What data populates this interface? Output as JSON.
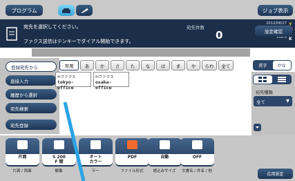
{
  "topbar": {
    "program_label": "プログラム",
    "job_label": "ジョブ表示"
  },
  "message": {
    "line1": "宛先を選択してください。",
    "line2": "ファクス送信はテンキーでダイアル開始できます。",
    "dest_count_label": "宛先件数",
    "dest_count": "0",
    "date": "2012/08/27",
    "time": "11:25",
    "memory": "メモリー残量 C",
    "memory_pct": "100%",
    "toner": [
      "Y",
      "M",
      "C",
      "K"
    ],
    "confirm_label": "設定確認"
  },
  "left_menu": [
    {
      "label": "登録宛先から",
      "active": true
    },
    {
      "label": "直接入力",
      "active": false
    },
    {
      "label": "履歴から選択",
      "active": false
    },
    {
      "label": "宛先検索",
      "active": false
    },
    {
      "label": "宛先登録",
      "active": false
    }
  ],
  "tabs": [
    "常用",
    "あ",
    "か",
    "さ",
    "た",
    "な",
    "は",
    "ま",
    "や",
    "らわ",
    "全て"
  ],
  "kana_toggle": [
    "英字",
    "かな"
  ],
  "addresses": [
    {
      "kind": "ファクス",
      "name": "tokyo-office"
    },
    {
      "kind": "ファクス",
      "name": "osaka-office"
    }
  ],
  "dest_type": {
    "label": "宛先種類",
    "value": "全て"
  },
  "bottom_functions": [
    {
      "label": "片面 / 両面",
      "value": "片面"
    },
    {
      "label": "解像",
      "value": "S 200\nF 精"
    },
    {
      "label": "ラー",
      "value": "オート\nカラー"
    },
    {
      "label": "ファイル形式",
      "value": "PDF"
    },
    {
      "label": "読込みサイズ",
      "value": "自動"
    },
    {
      "label": "文書名 / 件名 / 他",
      "value": "OFF"
    }
  ],
  "app_settings_label": "応用設定",
  "colors": {
    "navy": "#1d3555",
    "panel": "#1c2f4a",
    "accent": "#37a5d8",
    "pointer": "#2aa3e6"
  }
}
